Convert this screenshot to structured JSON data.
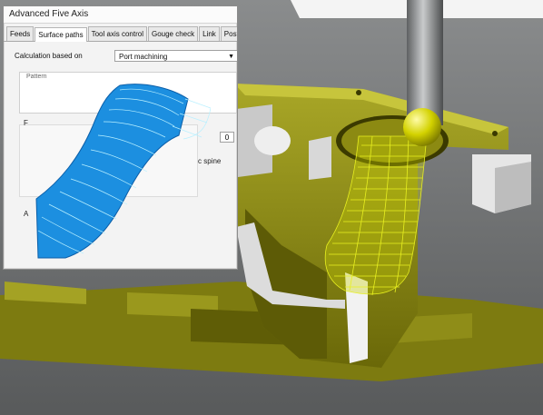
{
  "dialog": {
    "title": "Advanced Five Axis",
    "tabs": [
      "Feeds",
      "Surface paths",
      "Tool axis control",
      "Gouge check",
      "Link",
      "Post Settings"
    ],
    "active_tab": "Surface paths",
    "calc_label": "Calculation based on",
    "calc_value": "Port machining",
    "group_label": "Pattern",
    "fragment_p": "F",
    "fragment_a": "A",
    "fragment_spine": "c spine",
    "number_value": "0"
  },
  "colors": {
    "toolpath_blue": "#1c8fe0",
    "toolpath_yellow": "#d6e21e",
    "part_olive": "#8c8a12",
    "background_gray": "#6b6d6e"
  }
}
